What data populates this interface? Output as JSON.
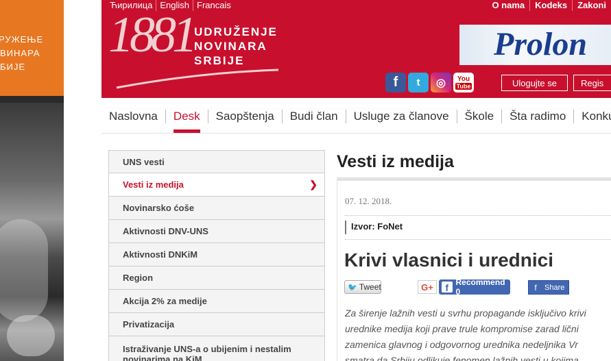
{
  "left_banner": {
    "lines": [
      "РУЖЕЊЕ",
      "ВИНАРА",
      "БИЈЕ"
    ]
  },
  "header": {
    "lang_links": [
      "Ћирилица",
      "English",
      "Francais"
    ],
    "top_links": [
      "O nama",
      "Kodeks",
      "Zakoni"
    ],
    "logo_number": "1881",
    "logo_lines": [
      "UDRUŽENJE",
      "NOVINARA",
      "SRBIJE"
    ],
    "banner_text": "Prolon",
    "login_label": "Ulogujte se",
    "register_label": "Regis"
  },
  "nav": {
    "items": [
      "Naslovna",
      "Desk",
      "Saopštenja",
      "Budi član",
      "Usluge za članove",
      "Škole",
      "Šta radimo",
      "Konkurs"
    ],
    "active": "Desk"
  },
  "sidebar": {
    "items": [
      "UNS vesti",
      "Vesti iz medija",
      "Novinarsko ćoše",
      "Aktivnosti DNV-UNS",
      "Aktivnosti DNKiM",
      "Region",
      "Akcija 2% za medije",
      "Privatizacija",
      "Istraživanje UNS-a o ubijenim i nestalim novinarima na KiM"
    ],
    "active": "Vesti iz medija"
  },
  "main": {
    "section_title": "Vesti iz medija",
    "date": "07. 12. 2018.",
    "source": "Izvor: FoNet",
    "article_title": "Krivi vlasnici i urednici",
    "share": {
      "tweet": "Tweet",
      "gplus": "G+",
      "recommend": "Recommend 0",
      "fb_share": "Share"
    },
    "body_lines": [
      "Za širenje lažnih vesti u svrhu propagande isključivo krivi",
      "urednike medija koji prave trule kompromise zarad lični",
      "zamenica glavnog i odgovornog urednika nedeljnika Vr",
      "smatra da Srbiju odlikuje fenomen lažnih vesti u kojima"
    ]
  },
  "colors": {
    "brand_red": "#c8102e",
    "left_orange": "#e87722",
    "facebook_blue": "#4267b2"
  }
}
